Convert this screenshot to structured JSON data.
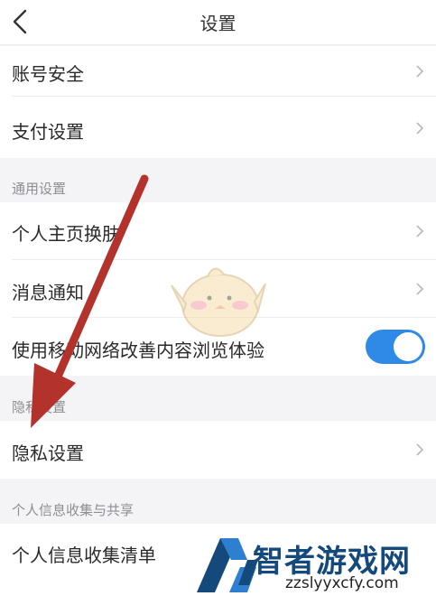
{
  "header": {
    "title": "设置",
    "back_icon": "chevron-left-icon"
  },
  "rows": {
    "account_security": "账号安全",
    "payment_settings": "支付设置",
    "homepage_skin": "个人主页换肤",
    "notifications": "消息通知",
    "mobile_network": "使用移动网络改善内容浏览体验",
    "privacy_settings": "隐私设置",
    "personal_info_list": "个人信息收集清单"
  },
  "sections": {
    "general": "通用设置",
    "privacy": "隐私设置",
    "personal_info": "个人信息收集与共享"
  },
  "toggle": {
    "mobile_network_on": true,
    "accent": "#2e8ae6"
  },
  "overlay": {
    "arrow_color": "#b3322c",
    "watermark_text": "智者游戏网",
    "watermark_url": "zzslyyxcfy.com",
    "watermark_logo_color": "#14497c"
  }
}
